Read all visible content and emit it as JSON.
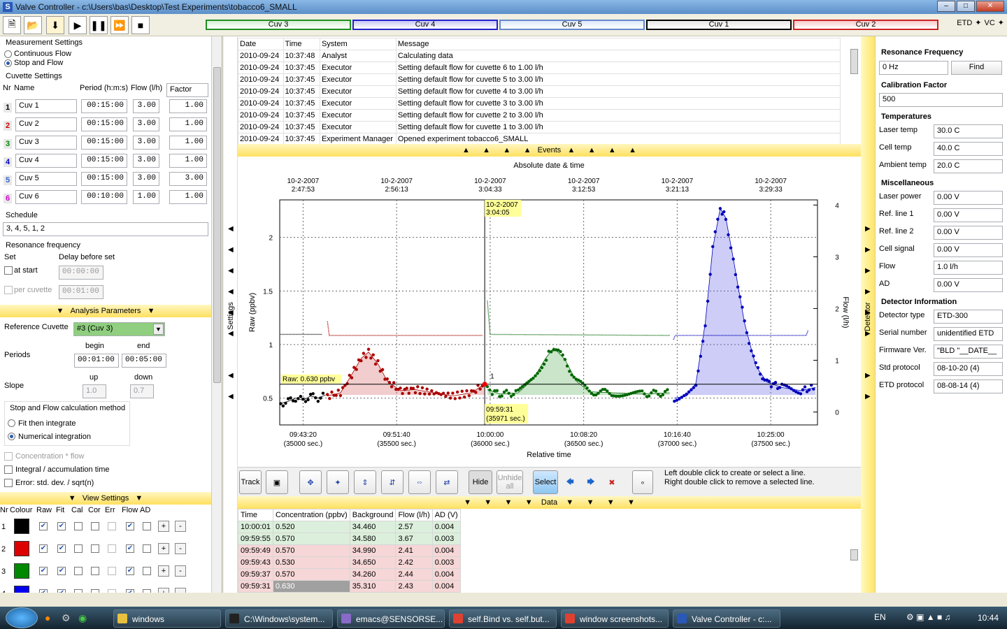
{
  "window": {
    "title": "Valve Controller - c:\\Users\\bas\\Desktop\\Test Experiments\\tobacco6_SMALL",
    "icon_letter": "S"
  },
  "toolbar": {
    "cuvettes": [
      {
        "label": "Cuv 3",
        "color": "#1f8f1f",
        "fill": "#d6efd6"
      },
      {
        "label": "Cuv 4",
        "color": "#2222cc",
        "fill": "#c6c6f4"
      },
      {
        "label": "Cuv 5",
        "color": "#6688cc",
        "fill": "#dde8fa"
      },
      {
        "label": "Cuv 1",
        "color": "#000000",
        "fill": "#e6e6e6"
      },
      {
        "label": "Cuv 2",
        "color": "#cc2222",
        "fill": "#f6c8c8"
      }
    ],
    "etd_label": "ETD",
    "vc_label": "VC"
  },
  "left": {
    "measurement_title": "Measurement Settings",
    "continuous_label": "Continuous Flow",
    "stopflow_label": "Stop and Flow",
    "cuvette_title": "Cuvette Settings",
    "cuvette_headers": {
      "nr": "Nr",
      "name": "Name",
      "period": "Period (h:m:s)",
      "flow": "Flow (l/h)",
      "factor": "Factor"
    },
    "cuvettes": [
      {
        "nr": "1",
        "name": "Cuv 1",
        "period": "00:15:00",
        "flow": "3.00",
        "factor": "1.00",
        "color": "#000000"
      },
      {
        "nr": "2",
        "name": "Cuv 2",
        "period": "00:15:00",
        "flow": "3.00",
        "factor": "1.00",
        "color": "#cc0000"
      },
      {
        "nr": "3",
        "name": "Cuv 3",
        "period": "00:15:00",
        "flow": "3.00",
        "factor": "1.00",
        "color": "#008800"
      },
      {
        "nr": "4",
        "name": "Cuv 4",
        "period": "00:15:00",
        "flow": "3.00",
        "factor": "1.00",
        "color": "#0000cc"
      },
      {
        "nr": "5",
        "name": "Cuv 5",
        "period": "00:15:00",
        "flow": "3.00",
        "factor": "3.00",
        "color": "#3366cc"
      },
      {
        "nr": "6",
        "name": "Cuv 6",
        "period": "00:10:00",
        "flow": "1.00",
        "factor": "1.00",
        "color": "#cc00cc"
      }
    ],
    "schedule_title": "Schedule",
    "schedule_value": "3, 4, 5, 1, 2",
    "resonance_title": "Resonance frequency",
    "set_label": "Set",
    "delay_label": "Delay before set",
    "at_start_label": "at start",
    "at_start_delay": "00:00:00",
    "per_cuvette_label": "per cuvette",
    "per_cuvette_delay": "00:01:00",
    "analysis_title": "Analysis Parameters",
    "reference_label": "Reference Cuvette",
    "reference_value": "#3 (Cuv 3)",
    "periods_label": "Periods",
    "begin_label": "begin",
    "end_label": "end",
    "begin_value": "00:01:00",
    "end_value": "00:05:00",
    "slope_label": "Slope",
    "up_label": "up",
    "down_label": "down",
    "up_value": "1.0",
    "down_value": "0.7",
    "method_title": "Stop and Flow calculation method",
    "fit_label": "Fit then integrate",
    "numerical_label": "Numerical integration",
    "concentration_label": "Concentration * flow",
    "integral_label": "Integral / accumulation time",
    "error_label": "Error: std. dev. / sqrt(n)",
    "view_title": "View Settings",
    "view_headers": [
      "Nr",
      "Colour",
      "Raw",
      "Fit",
      "Cal",
      "Cor",
      "Err",
      "Flow",
      "AD"
    ],
    "view_rows": [
      {
        "nr": "1",
        "color": "#000000"
      },
      {
        "nr": "2",
        "color": "#dd0000"
      },
      {
        "nr": "3",
        "color": "#008800"
      },
      {
        "nr": "4",
        "color": "#0000ee"
      }
    ],
    "plus": "+",
    "minus": "-"
  },
  "strips": {
    "settings": "Settings",
    "detector": "Detector"
  },
  "events": {
    "headers": [
      "Date",
      "Time",
      "System",
      "Message"
    ],
    "title": "Events",
    "rows": [
      [
        "2010-09-24",
        "10:37:48",
        "Analyst",
        "Calculating data"
      ],
      [
        "2010-09-24",
        "10:37:45",
        "Executor",
        "Setting default flow for cuvette 6 to 1.00 l/h"
      ],
      [
        "2010-09-24",
        "10:37:45",
        "Executor",
        "Setting default flow for cuvette 5 to 3.00 l/h"
      ],
      [
        "2010-09-24",
        "10:37:45",
        "Executor",
        "Setting default flow for cuvette 4 to 3.00 l/h"
      ],
      [
        "2010-09-24",
        "10:37:45",
        "Executor",
        "Setting default flow for cuvette 3 to 3.00 l/h"
      ],
      [
        "2010-09-24",
        "10:37:45",
        "Executor",
        "Setting default flow for cuvette 2 to 3.00 l/h"
      ],
      [
        "2010-09-24",
        "10:37:45",
        "Executor",
        "Setting default flow for cuvette 1 to 3.00 l/h"
      ],
      [
        "2010-09-24",
        "10:37:45",
        "Experiment Manager",
        "Opened experiment tobacco6_SMALL"
      ]
    ]
  },
  "chart": {
    "top_title": "Absolute date & time",
    "bottom_title": "Relative time",
    "ylabel": "Raw (ppbv)",
    "y2label": "Flow (l/h)",
    "top_ticks": [
      [
        "10-2-2007",
        "2:47:53"
      ],
      [
        "10-2-2007",
        "2:56:13"
      ],
      [
        "10-2-2007",
        "3:04:33"
      ],
      [
        "10-2-2007",
        "3:12:53"
      ],
      [
        "10-2-2007",
        "3:21:13"
      ],
      [
        "10-2-2007",
        "3:29:33"
      ]
    ],
    "bottom_ticks": [
      [
        "09:43:20",
        "(35000 sec.)"
      ],
      [
        "09:51:40",
        "(35500 sec.)"
      ],
      [
        "10:00:00",
        "(36000 sec.)"
      ],
      [
        "10:08:20",
        "(36500 sec.)"
      ],
      [
        "10:16:40",
        "(37000 sec.)"
      ],
      [
        "10:25:00",
        "(37500 sec.)"
      ]
    ],
    "yticks": [
      "0.5",
      "1",
      "1.5",
      "2"
    ],
    "y2ticks": [
      "0",
      "1",
      "2",
      "3",
      "4"
    ],
    "cursor_top": [
      "10-2-2007",
      "3:04:05"
    ],
    "cursor_bottom": [
      "09:59:31",
      "(35971 sec.)"
    ],
    "raw_label": "Raw: 0.630 ppbv",
    "marker": "1"
  },
  "chart_data": {
    "type": "scatter",
    "xlabel": "Relative time",
    "ylabel": "Raw (ppbv)",
    "y2label": "Flow (l/h)",
    "xlim": [
      34875,
      37750
    ],
    "ylim": [
      0.25,
      2.35
    ],
    "y2lim": [
      -0.25,
      4.1
    ],
    "series": [
      {
        "name": "Cuv 1",
        "color": "#000000",
        "raw": [
          [
            34880,
            0.45
          ],
          [
            34920,
            0.47
          ],
          [
            34960,
            0.5
          ],
          [
            35000,
            0.48
          ],
          [
            35040,
            0.52
          ],
          [
            35080,
            0.5
          ],
          [
            35120,
            0.53
          ]
        ],
        "flow": [
          [
            34880,
            1.5
          ],
          [
            35100,
            1.5
          ]
        ]
      },
      {
        "name": "Cuv 2",
        "color": "#aa0000",
        "raw": [
          [
            35130,
            0.52
          ],
          [
            35200,
            0.55
          ],
          [
            35260,
            0.72
          ],
          [
            35310,
            0.87
          ],
          [
            35350,
            0.93
          ],
          [
            35400,
            0.82
          ],
          [
            35450,
            0.66
          ],
          [
            35520,
            0.57
          ],
          [
            35600,
            0.58
          ],
          [
            35700,
            0.55
          ],
          [
            35800,
            0.52
          ],
          [
            35900,
            0.55
          ],
          [
            35970,
            0.63
          ]
        ],
        "flow": [
          [
            35130,
            1.75
          ],
          [
            35140,
            1.48
          ],
          [
            35960,
            1.48
          ]
        ]
      },
      {
        "name": "Cuv 3",
        "color": "#006600",
        "raw": [
          [
            35985,
            0.58
          ],
          [
            36050,
            0.54
          ],
          [
            36150,
            0.55
          ],
          [
            36230,
            0.68
          ],
          [
            36300,
            0.88
          ],
          [
            36340,
            0.97
          ],
          [
            36400,
            0.86
          ],
          [
            36460,
            0.66
          ],
          [
            36530,
            0.56
          ],
          [
            36650,
            0.55
          ],
          [
            36800,
            0.54
          ],
          [
            36960,
            0.55
          ]
        ],
        "flow": [
          [
            35985,
            2.15
          ],
          [
            36000,
            1.5
          ],
          [
            36960,
            1.48
          ]
        ]
      },
      {
        "name": "Cuv 4",
        "color": "#0000bb",
        "raw": [
          [
            36985,
            0.5
          ],
          [
            37050,
            0.52
          ],
          [
            37100,
            0.64
          ],
          [
            37150,
            1.2
          ],
          [
            37190,
            1.9
          ],
          [
            37230,
            2.27
          ],
          [
            37260,
            2.18
          ],
          [
            37300,
            1.8
          ],
          [
            37360,
            1.2
          ],
          [
            37420,
            0.8
          ],
          [
            37480,
            0.65
          ],
          [
            37560,
            0.6
          ],
          [
            37660,
            0.57
          ],
          [
            37740,
            0.6
          ]
        ],
        "flow": [
          [
            36980,
            1.4
          ],
          [
            36990,
            1.48
          ],
          [
            37690,
            1.48
          ],
          [
            37700,
            1.58
          ]
        ]
      }
    ]
  },
  "toolbar2": {
    "track": "Track",
    "hide": "Hide",
    "unhide": "Unhide all",
    "select": "Select",
    "hint1": "Left double click to create or select a line.",
    "hint2": "Right double click to remove a selected line.",
    "data_title": "Data"
  },
  "data": {
    "headers": [
      "Time",
      "Concentration (ppbv)",
      "Background",
      "Flow (l/h)",
      "AD (V)"
    ],
    "rows": [
      {
        "time": "10:00:01",
        "conc": "0.520",
        "bg": "34.460",
        "flow": "2.57",
        "ad": "0.004",
        "bgc": "#dcefdc"
      },
      {
        "time": "09:59:55",
        "conc": "0.570",
        "bg": "34.580",
        "flow": "3.67",
        "ad": "0.003",
        "bgc": "#dcefdc"
      },
      {
        "time": "09:59:49",
        "conc": "0.570",
        "bg": "34.990",
        "flow": "2.41",
        "ad": "0.004",
        "bgc": "#f6d6d6"
      },
      {
        "time": "09:59:43",
        "conc": "0.530",
        "bg": "34.650",
        "flow": "2.42",
        "ad": "0.003",
        "bgc": "#f6d6d6"
      },
      {
        "time": "09:59:37",
        "conc": "0.570",
        "bg": "34.260",
        "flow": "2.44",
        "ad": "0.004",
        "bgc": "#f6d6d6"
      },
      {
        "time": "09:59:31",
        "conc": "0.630",
        "bg": "35.310",
        "flow": "2.43",
        "ad": "0.004",
        "bgc": "#f6d6d6"
      }
    ]
  },
  "right": {
    "resonance_title": "Resonance Frequency",
    "resonance_value": "0 Hz",
    "find_label": "Find",
    "calibration_title": "Calibration Factor",
    "calibration_value": "500",
    "temperatures_title": "Temperatures",
    "temps": [
      [
        "Laser temp",
        "30.0 C"
      ],
      [
        "Cell temp",
        "40.0 C"
      ],
      [
        "Ambient temp",
        "20.0 C"
      ]
    ],
    "misc_title": "Miscellaneous",
    "misc": [
      [
        "Laser power",
        "0.00 V"
      ],
      [
        "Ref. line 1",
        "0.00 V"
      ],
      [
        "Ref. line 2",
        "0.00 V"
      ],
      [
        "Cell signal",
        "0.00 V"
      ],
      [
        "Flow",
        "1.0 l/h"
      ],
      [
        "AD",
        "0.00 V"
      ]
    ],
    "detector_title": "Detector Information",
    "detector": [
      [
        "Detector type",
        "ETD-300"
      ],
      [
        "Serial number",
        "unidentified ETD"
      ],
      [
        "Firmware Ver.",
        "\"BLD \"__DATE__"
      ],
      [
        "Std protocol",
        "08-10-20 (4)"
      ],
      [
        "ETD protocol",
        "08-08-14 (4)"
      ]
    ]
  },
  "taskbar": {
    "items": [
      {
        "label": "windows",
        "color": "#e8c040"
      },
      {
        "label": "C:\\Windows\\system...",
        "color": "#222222"
      },
      {
        "label": "emacs@SENSORSE...",
        "color": "#8a6ac8"
      },
      {
        "label": "self.Bind vs. self.but...",
        "color": "#e04030"
      },
      {
        "label": "window screenshots...",
        "color": "#e04030"
      },
      {
        "label": "Valve Controller - c:...",
        "color": "#2a58b8"
      }
    ],
    "lang": "EN",
    "clock": "10:44"
  }
}
